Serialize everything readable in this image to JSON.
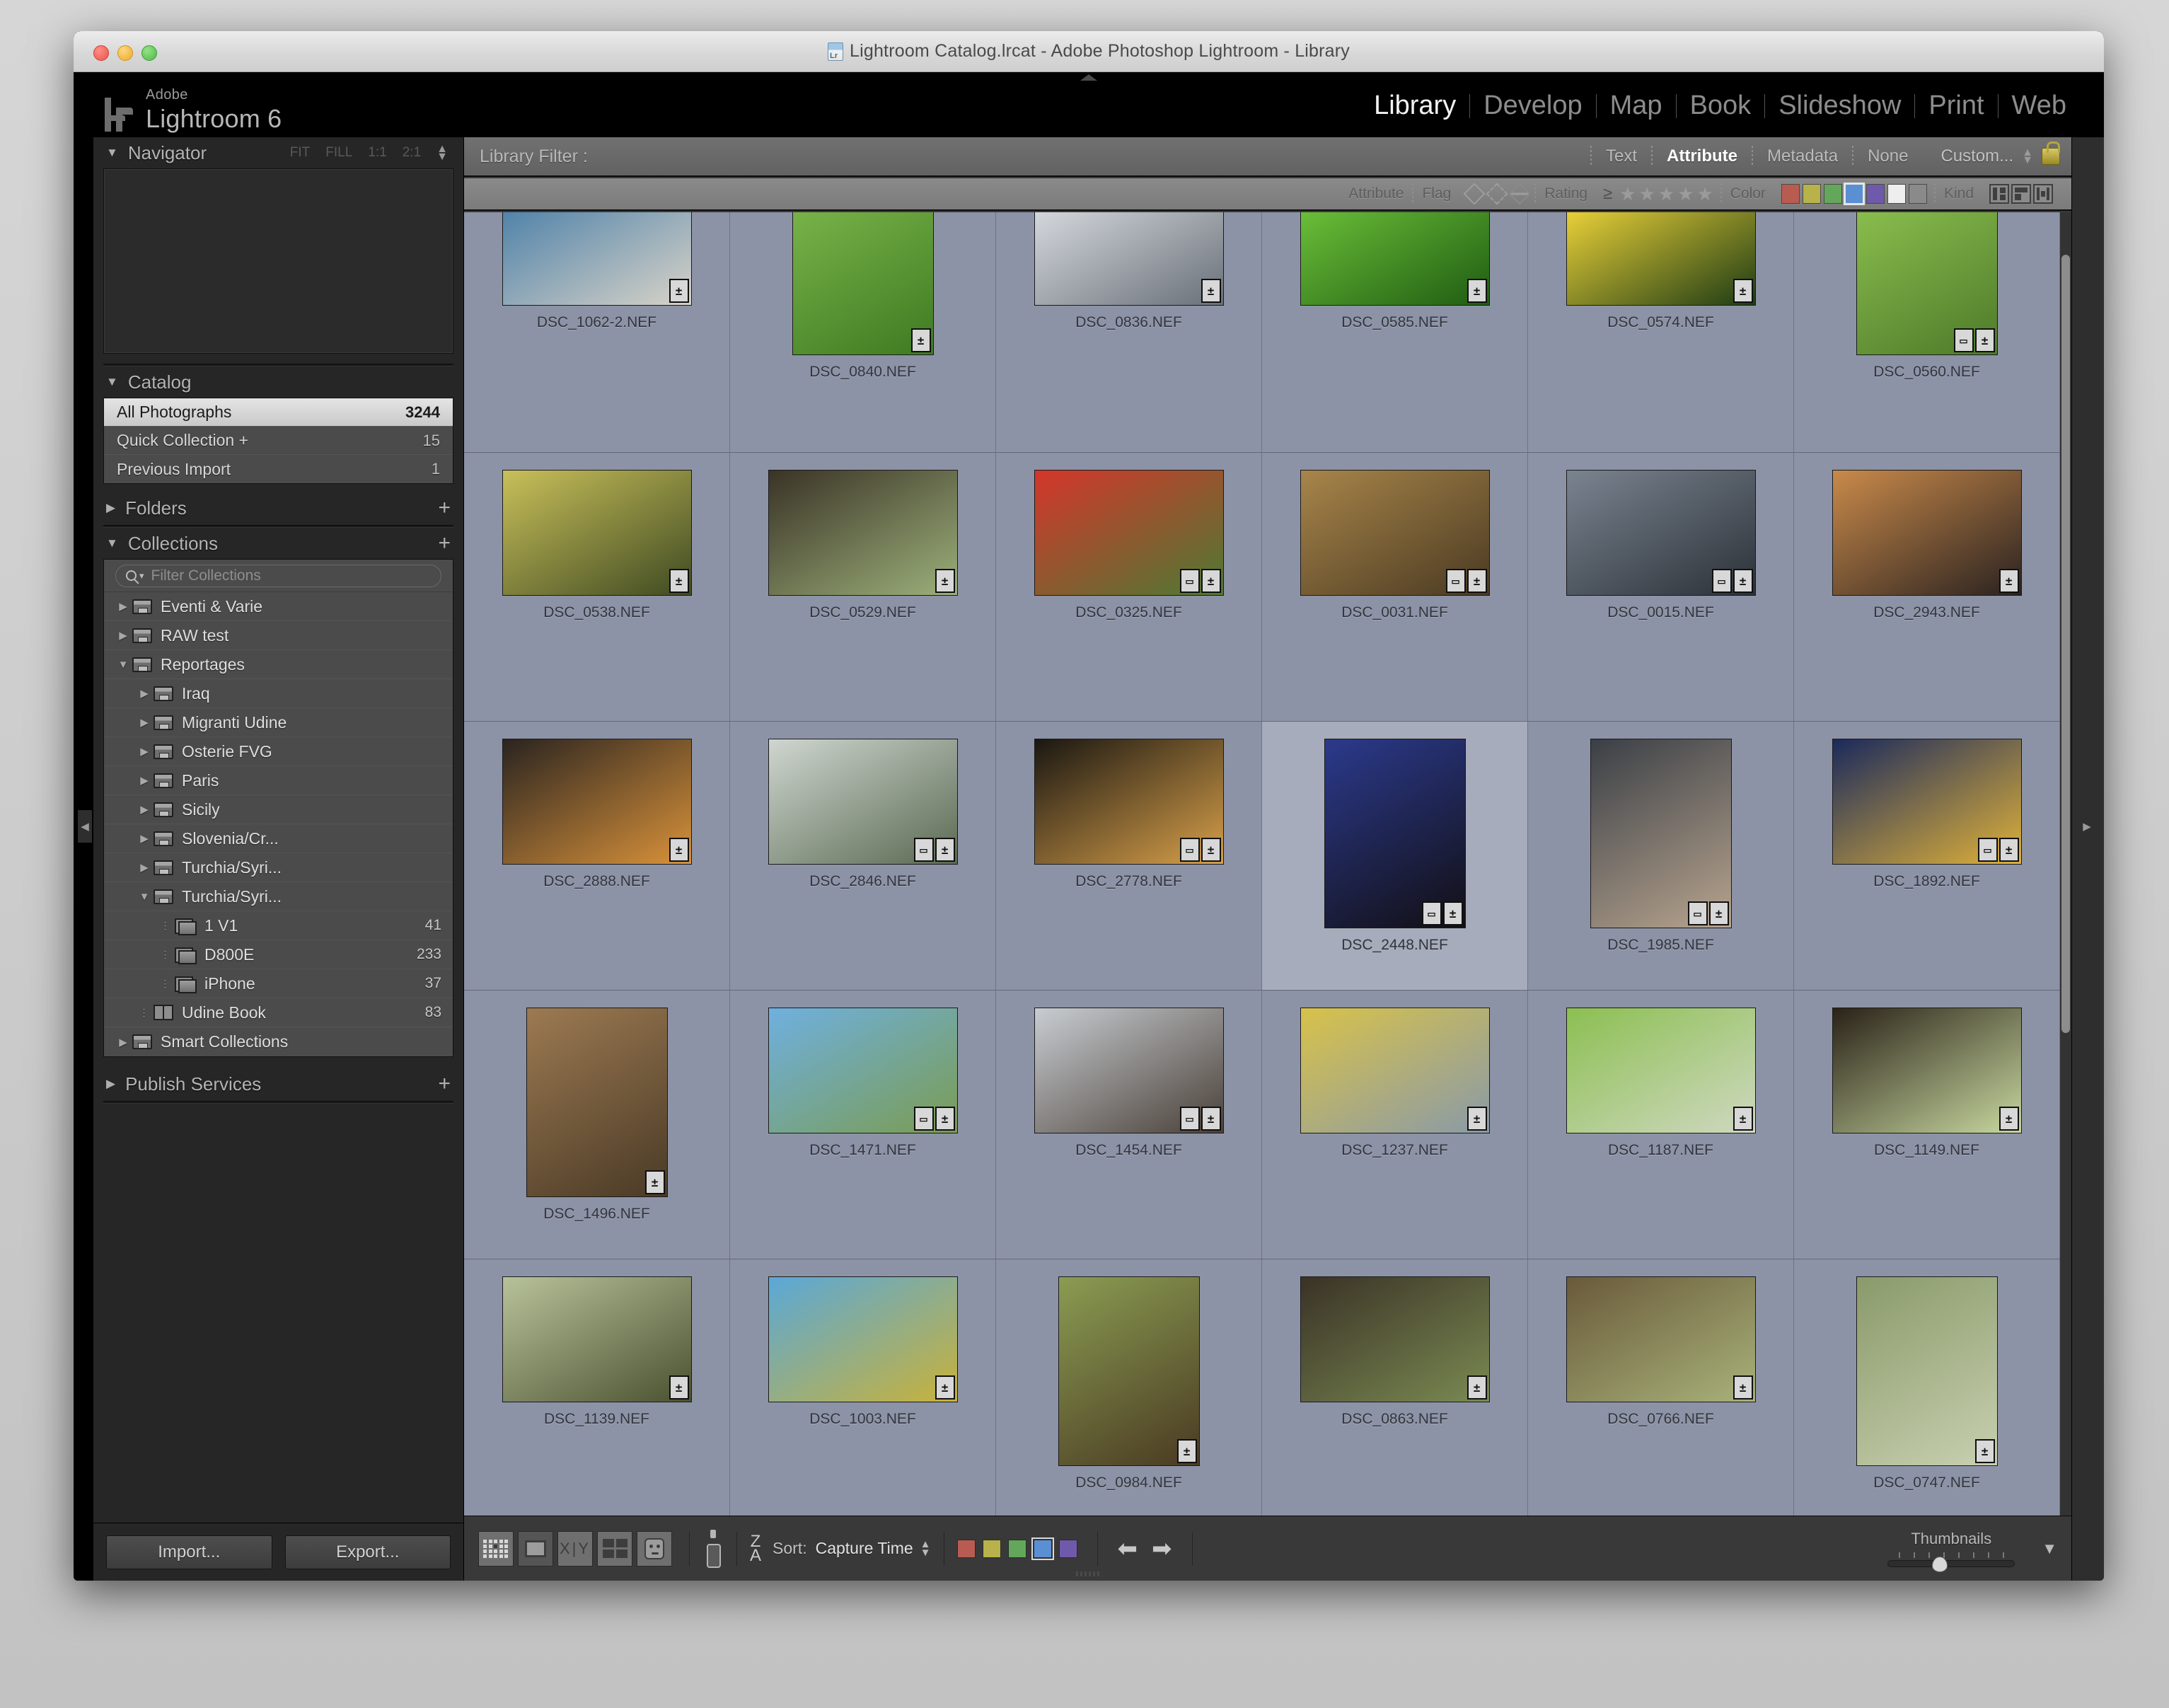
{
  "window": {
    "title": "Lightroom Catalog.lrcat - Adobe Photoshop Lightroom - Library"
  },
  "branding": {
    "adobe": "Adobe",
    "product": "Lightroom 6"
  },
  "modules": [
    {
      "label": "Library",
      "active": true
    },
    {
      "label": "Develop",
      "active": false
    },
    {
      "label": "Map",
      "active": false
    },
    {
      "label": "Book",
      "active": false
    },
    {
      "label": "Slideshow",
      "active": false
    },
    {
      "label": "Print",
      "active": false
    },
    {
      "label": "Web",
      "active": false
    }
  ],
  "navigator": {
    "title": "Navigator",
    "zoom_levels": [
      "FIT",
      "FILL",
      "1:1",
      "2:1"
    ]
  },
  "catalog": {
    "title": "Catalog",
    "items": [
      {
        "name": "All Photographs",
        "count": "3244",
        "selected": true
      },
      {
        "name": "Quick Collection  +",
        "count": "15",
        "selected": false
      },
      {
        "name": "Previous Import",
        "count": "1",
        "selected": false
      }
    ]
  },
  "folders": {
    "title": "Folders"
  },
  "collections": {
    "title": "Collections",
    "filter_placeholder": "Filter Collections",
    "items": [
      {
        "label": "Eventi & Varie",
        "indent": 0,
        "twisty": "right",
        "icon": "box-icon",
        "count": ""
      },
      {
        "label": "RAW test",
        "indent": 0,
        "twisty": "right",
        "icon": "box-icon",
        "count": ""
      },
      {
        "label": "Reportages",
        "indent": 0,
        "twisty": "down",
        "icon": "box-icon",
        "count": ""
      },
      {
        "label": "Iraq",
        "indent": 1,
        "twisty": "right",
        "icon": "box-icon",
        "count": ""
      },
      {
        "label": "Migranti Udine",
        "indent": 1,
        "twisty": "right",
        "icon": "box-icon",
        "count": ""
      },
      {
        "label": "Osterie FVG",
        "indent": 1,
        "twisty": "right",
        "icon": "box-icon",
        "count": ""
      },
      {
        "label": "Paris",
        "indent": 1,
        "twisty": "right",
        "icon": "box-icon",
        "count": ""
      },
      {
        "label": "Sicily",
        "indent": 1,
        "twisty": "right",
        "icon": "box-icon",
        "count": ""
      },
      {
        "label": "Slovenia/Cr...",
        "indent": 1,
        "twisty": "right",
        "icon": "box-icon",
        "count": ""
      },
      {
        "label": "Turchia/Syri...",
        "indent": 1,
        "twisty": "right",
        "icon": "box-icon",
        "count": ""
      },
      {
        "label": "Turchia/Syri...",
        "indent": 1,
        "twisty": "down",
        "icon": "box-icon",
        "count": ""
      },
      {
        "label": "1 V1",
        "indent": 2,
        "twisty": "dots",
        "icon": "stack-icon",
        "count": "41"
      },
      {
        "label": "D800E",
        "indent": 2,
        "twisty": "dots",
        "icon": "stack-icon",
        "count": "233"
      },
      {
        "label": "iPhone",
        "indent": 2,
        "twisty": "dots",
        "icon": "stack-icon",
        "count": "37"
      },
      {
        "label": "Udine Book",
        "indent": 1,
        "twisty": "dots",
        "icon": "book-icon",
        "count": "83"
      },
      {
        "label": "Smart Collections",
        "indent": 0,
        "twisty": "right",
        "icon": "box-icon",
        "count": ""
      }
    ]
  },
  "publish_services": {
    "title": "Publish Services"
  },
  "left_buttons": {
    "import": "Import...",
    "export": "Export..."
  },
  "library_filter": {
    "label": "Library Filter :",
    "tabs": [
      {
        "label": "Text",
        "active": false
      },
      {
        "label": "Attribute",
        "active": true
      },
      {
        "label": "Metadata",
        "active": false
      },
      {
        "label": "None",
        "active": false
      }
    ],
    "preset": "Custom...",
    "lock_icon": "lock-icon"
  },
  "attribute_bar": {
    "attribute_label": "Attribute",
    "flag_label": "Flag",
    "rating_label": "Rating",
    "rating_operator": "≥",
    "stars": 5,
    "color_label": "Color",
    "color_swatches": [
      "#b85c52",
      "#b8b24a",
      "#63a85a",
      "#5b8fd4",
      "#6f59ab",
      "#eeeeee",
      "#8a8a8a"
    ],
    "color_selected_index": 3,
    "kind_label": "Kind"
  },
  "grid": {
    "photos": [
      {
        "file": "DSC_1062-2.NEF",
        "orient": "landscape",
        "badges": [
          "develop"
        ],
        "c1": "#4a7fa8",
        "c2": "#d8d3c8",
        "sel": false,
        "clip": true
      },
      {
        "file": "DSC_0840.NEF",
        "orient": "portrait",
        "badges": [
          "develop"
        ],
        "c1": "#7ab54a",
        "c2": "#3f7a22",
        "sel": false,
        "clip": true
      },
      {
        "file": "DSC_0836.NEF",
        "orient": "landscape",
        "badges": [
          "develop"
        ],
        "c1": "#d9dde2",
        "c2": "#6a7078",
        "sel": false,
        "clip": true
      },
      {
        "file": "DSC_0585.NEF",
        "orient": "landscape",
        "badges": [
          "develop"
        ],
        "c1": "#6ec33a",
        "c2": "#1f5c12",
        "sel": false,
        "clip": true
      },
      {
        "file": "DSC_0574.NEF",
        "orient": "landscape",
        "badges": [
          "develop"
        ],
        "c1": "#f2d73a",
        "c2": "#1d3b14",
        "sel": false,
        "clip": true
      },
      {
        "file": "DSC_0560.NEF",
        "orient": "portrait",
        "badges": [
          "crop",
          "develop"
        ],
        "c1": "#8cc04f",
        "c2": "#4d7a2a",
        "sel": false,
        "clip": true
      },
      {
        "file": "DSC_0538.NEF",
        "orient": "landscape",
        "badges": [
          "develop"
        ],
        "c1": "#c9c05a",
        "c2": "#3f4a22",
        "sel": false,
        "clip": false
      },
      {
        "file": "DSC_0529.NEF",
        "orient": "landscape",
        "badges": [
          "develop"
        ],
        "c1": "#3a3326",
        "c2": "#9cb07a",
        "sel": false,
        "clip": false
      },
      {
        "file": "DSC_0325.NEF",
        "orient": "landscape",
        "badges": [
          "crop",
          "develop"
        ],
        "c1": "#d4352a",
        "c2": "#4d7a33",
        "sel": false,
        "clip": false
      },
      {
        "file": "DSC_0031.NEF",
        "orient": "landscape",
        "badges": [
          "crop",
          "develop"
        ],
        "c1": "#a8854a",
        "c2": "#4a3a22",
        "sel": false,
        "clip": false
      },
      {
        "file": "DSC_0015.NEF",
        "orient": "landscape",
        "badges": [
          "crop",
          "develop"
        ],
        "c1": "#7a8490",
        "c2": "#2b3138",
        "sel": false,
        "clip": false
      },
      {
        "file": "DSC_2943.NEF",
        "orient": "landscape",
        "badges": [
          "develop"
        ],
        "c1": "#c98a4a",
        "c2": "#2a2220",
        "sel": false,
        "clip": false
      },
      {
        "file": "DSC_2888.NEF",
        "orient": "landscape",
        "badges": [
          "develop"
        ],
        "c1": "#2a2420",
        "c2": "#d9923a",
        "sel": false,
        "clip": false
      },
      {
        "file": "DSC_2846.NEF",
        "orient": "landscape",
        "badges": [
          "crop",
          "develop"
        ],
        "c1": "#cfd6d0",
        "c2": "#5a6a52",
        "sel": false,
        "clip": false
      },
      {
        "file": "DSC_2778.NEF",
        "orient": "landscape",
        "badges": [
          "crop",
          "develop"
        ],
        "c1": "#1a1712",
        "c2": "#d8a04a",
        "sel": false,
        "clip": false
      },
      {
        "file": "DSC_2448.NEF",
        "orient": "portrait",
        "badges": [
          "crop",
          "develop"
        ],
        "c1": "#2b3a8c",
        "c2": "#120f14",
        "sel": true,
        "clip": false
      },
      {
        "file": "DSC_1985.NEF",
        "orient": "portrait",
        "badges": [
          "crop",
          "develop"
        ],
        "c1": "#3a3f46",
        "c2": "#b8a48e",
        "sel": false,
        "clip": false
      },
      {
        "file": "DSC_1892.NEF",
        "orient": "landscape",
        "badges": [
          "crop",
          "develop"
        ],
        "c1": "#1b2a5c",
        "c2": "#e0b23a",
        "sel": false,
        "clip": false
      },
      {
        "file": "DSC_1496.NEF",
        "orient": "portrait",
        "badges": [
          "develop"
        ],
        "c1": "#9c7a52",
        "c2": "#4a3a26",
        "sel": false,
        "clip": false
      },
      {
        "file": "DSC_1471.NEF",
        "orient": "landscape",
        "badges": [
          "crop",
          "develop"
        ],
        "c1": "#6fb0e0",
        "c2": "#7a9c52",
        "sel": false,
        "clip": false
      },
      {
        "file": "DSC_1454.NEF",
        "orient": "landscape",
        "badges": [
          "crop",
          "develop"
        ],
        "c1": "#c8cdd2",
        "c2": "#4a4038",
        "sel": false,
        "clip": false
      },
      {
        "file": "DSC_1237.NEF",
        "orient": "landscape",
        "badges": [
          "develop"
        ],
        "c1": "#d8c24a",
        "c2": "#8a9aa8",
        "sel": false,
        "clip": false
      },
      {
        "file": "DSC_1187.NEF",
        "orient": "landscape",
        "badges": [
          "develop"
        ],
        "c1": "#8cbf52",
        "c2": "#cfd8c0",
        "sel": false,
        "clip": false
      },
      {
        "file": "DSC_1149.NEF",
        "orient": "landscape",
        "badges": [
          "develop"
        ],
        "c1": "#2a2218",
        "c2": "#c8d8a0",
        "sel": false,
        "clip": false
      },
      {
        "file": "DSC_1139.NEF",
        "orient": "landscape",
        "badges": [
          "develop"
        ],
        "c1": "#b8c29a",
        "c2": "#4a5230",
        "sel": false,
        "clip": false
      },
      {
        "file": "DSC_1003.NEF",
        "orient": "landscape",
        "badges": [
          "develop"
        ],
        "c1": "#5aa8d8",
        "c2": "#c8b23a",
        "sel": false,
        "clip": false
      },
      {
        "file": "DSC_0984.NEF",
        "orient": "portrait",
        "badges": [
          "develop"
        ],
        "c1": "#8a9c52",
        "c2": "#4a3a22",
        "sel": false,
        "clip": false
      },
      {
        "file": "DSC_0863.NEF",
        "orient": "landscape",
        "badges": [
          "develop"
        ],
        "c1": "#3a3226",
        "c2": "#7a8a52",
        "sel": false,
        "clip": false
      },
      {
        "file": "DSC_0766.NEF",
        "orient": "landscape",
        "badges": [
          "develop"
        ],
        "c1": "#6a5a3a",
        "c2": "#a8b27a",
        "sel": false,
        "clip": false
      },
      {
        "file": "DSC_0747.NEF",
        "orient": "portrait",
        "badges": [
          "develop"
        ],
        "c1": "#8a9a6a",
        "c2": "#c8d0b0",
        "sel": false,
        "clip": false
      }
    ]
  },
  "toolbar": {
    "view_icons": [
      "grid-view-icon",
      "loupe-view-icon",
      "compare-view-icon",
      "survey-view-icon",
      "people-view-icon"
    ],
    "painter_icon": "spray-can-icon",
    "sort_icon": "sort-za-icon",
    "sort_label": "Sort:",
    "sort_value": "Capture Time",
    "color_swatches": [
      "#b85c52",
      "#b8b24a",
      "#63a85a",
      "#5b8fd4",
      "#6f59ab"
    ],
    "color_selected_index": 3,
    "prev_icon": "arrow-left-icon",
    "next_icon": "arrow-right-icon",
    "thumbnails_label": "Thumbnails"
  }
}
